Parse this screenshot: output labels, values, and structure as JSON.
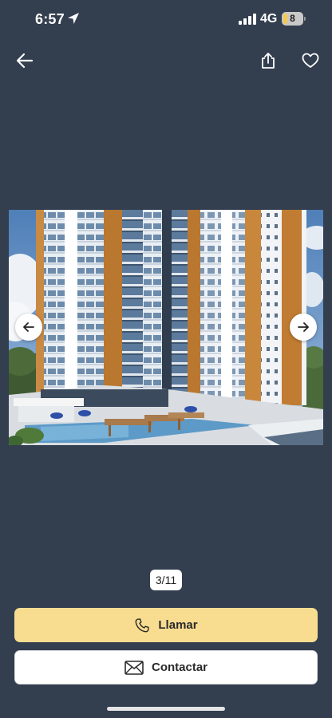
{
  "status_bar": {
    "time": "6:57",
    "network": "4G",
    "battery_level": "8"
  },
  "header": {
    "back_icon": "arrow-left-icon",
    "share_icon": "share-icon",
    "favorite_icon": "heart-icon"
  },
  "gallery": {
    "current_page": 3,
    "total_pages": 11,
    "counter": "3/11"
  },
  "actions": {
    "call_label": "Llamar",
    "call_icon": "phone-icon",
    "contact_label": "Contactar",
    "contact_icon": "envelope-icon"
  },
  "colors": {
    "background": "#333e4f",
    "call_button": "#f8dd91",
    "contact_button": "#ffffff"
  }
}
